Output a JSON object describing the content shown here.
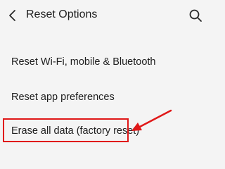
{
  "header": {
    "title": "Reset Options",
    "back_icon": "chevron-left-icon",
    "search_icon": "search-icon"
  },
  "menu": {
    "items": [
      {
        "label": "Reset Wi-Fi, mobile & Bluetooth"
      },
      {
        "label": "Reset app preferences"
      },
      {
        "label": "Erase all data (factory reset)"
      }
    ]
  },
  "annotation": {
    "color": "#e01818"
  }
}
